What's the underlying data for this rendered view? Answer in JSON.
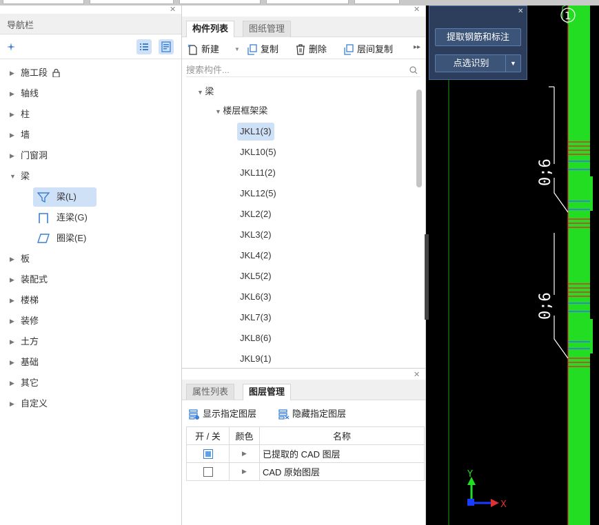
{
  "nav": {
    "title": "导航栏",
    "items": [
      {
        "label": "施工段",
        "expanded": false,
        "locked": true
      },
      {
        "label": "轴线",
        "expanded": false
      },
      {
        "label": "柱",
        "expanded": false
      },
      {
        "label": "墙",
        "expanded": false
      },
      {
        "label": "门窗洞",
        "expanded": false
      },
      {
        "label": "梁",
        "expanded": true
      },
      {
        "label": "板",
        "expanded": false
      },
      {
        "label": "装配式",
        "expanded": false
      },
      {
        "label": "楼梯",
        "expanded": false
      },
      {
        "label": "装修",
        "expanded": false
      },
      {
        "label": "土方",
        "expanded": false
      },
      {
        "label": "基础",
        "expanded": false
      },
      {
        "label": "其它",
        "expanded": false
      },
      {
        "label": "自定义",
        "expanded": false
      }
    ],
    "beam_children": [
      {
        "label": "梁(L)",
        "icon": "beam-icon",
        "selected": true
      },
      {
        "label": "连梁(G)",
        "icon": "link-beam-icon",
        "selected": false
      },
      {
        "label": "圈梁(E)",
        "icon": "ring-beam-icon",
        "selected": false
      }
    ]
  },
  "components": {
    "tabs": [
      {
        "label": "构件列表",
        "active": true
      },
      {
        "label": "图纸管理",
        "active": false
      }
    ],
    "toolbar": {
      "new": "新建",
      "copy": "复制",
      "delete": "删除",
      "floor_copy": "层间复制"
    },
    "search_placeholder": "搜索构件...",
    "tree_root": "梁",
    "tree_group": "楼层框架梁",
    "items": [
      "JKL1(3)",
      "JKL10(5)",
      "JKL11(2)",
      "JKL12(5)",
      "JKL2(2)",
      "JKL3(2)",
      "JKL4(2)",
      "JKL5(2)",
      "JKL6(3)",
      "JKL7(3)",
      "JKL8(6)",
      "JKL9(1)"
    ],
    "selected_item": "JKL1(3)"
  },
  "layers": {
    "tabs": [
      {
        "label": "属性列表",
        "active": false
      },
      {
        "label": "图层管理",
        "active": true
      }
    ],
    "show_label": "显示指定图层",
    "hide_label": "隐藏指定图层",
    "columns": [
      "开 / 关",
      "颜色",
      "名称"
    ],
    "rows": [
      {
        "name": "已提取的 CAD 图层",
        "checked": true
      },
      {
        "name": "CAD 原始图层",
        "checked": false
      }
    ]
  },
  "cad": {
    "extract_button": "提取钢筋和标注",
    "pick_button": "点选识别",
    "axis_marker": "1",
    "dimension_labels": [
      "0;6",
      "0;6"
    ],
    "axis_x": "X",
    "axis_y": "Y",
    "colors": {
      "background": "#000000",
      "beam": "#22dd22",
      "rebar_red": "#e03030",
      "rebar_blue": "#3a6cff",
      "dim_white": "#ffffff"
    }
  }
}
